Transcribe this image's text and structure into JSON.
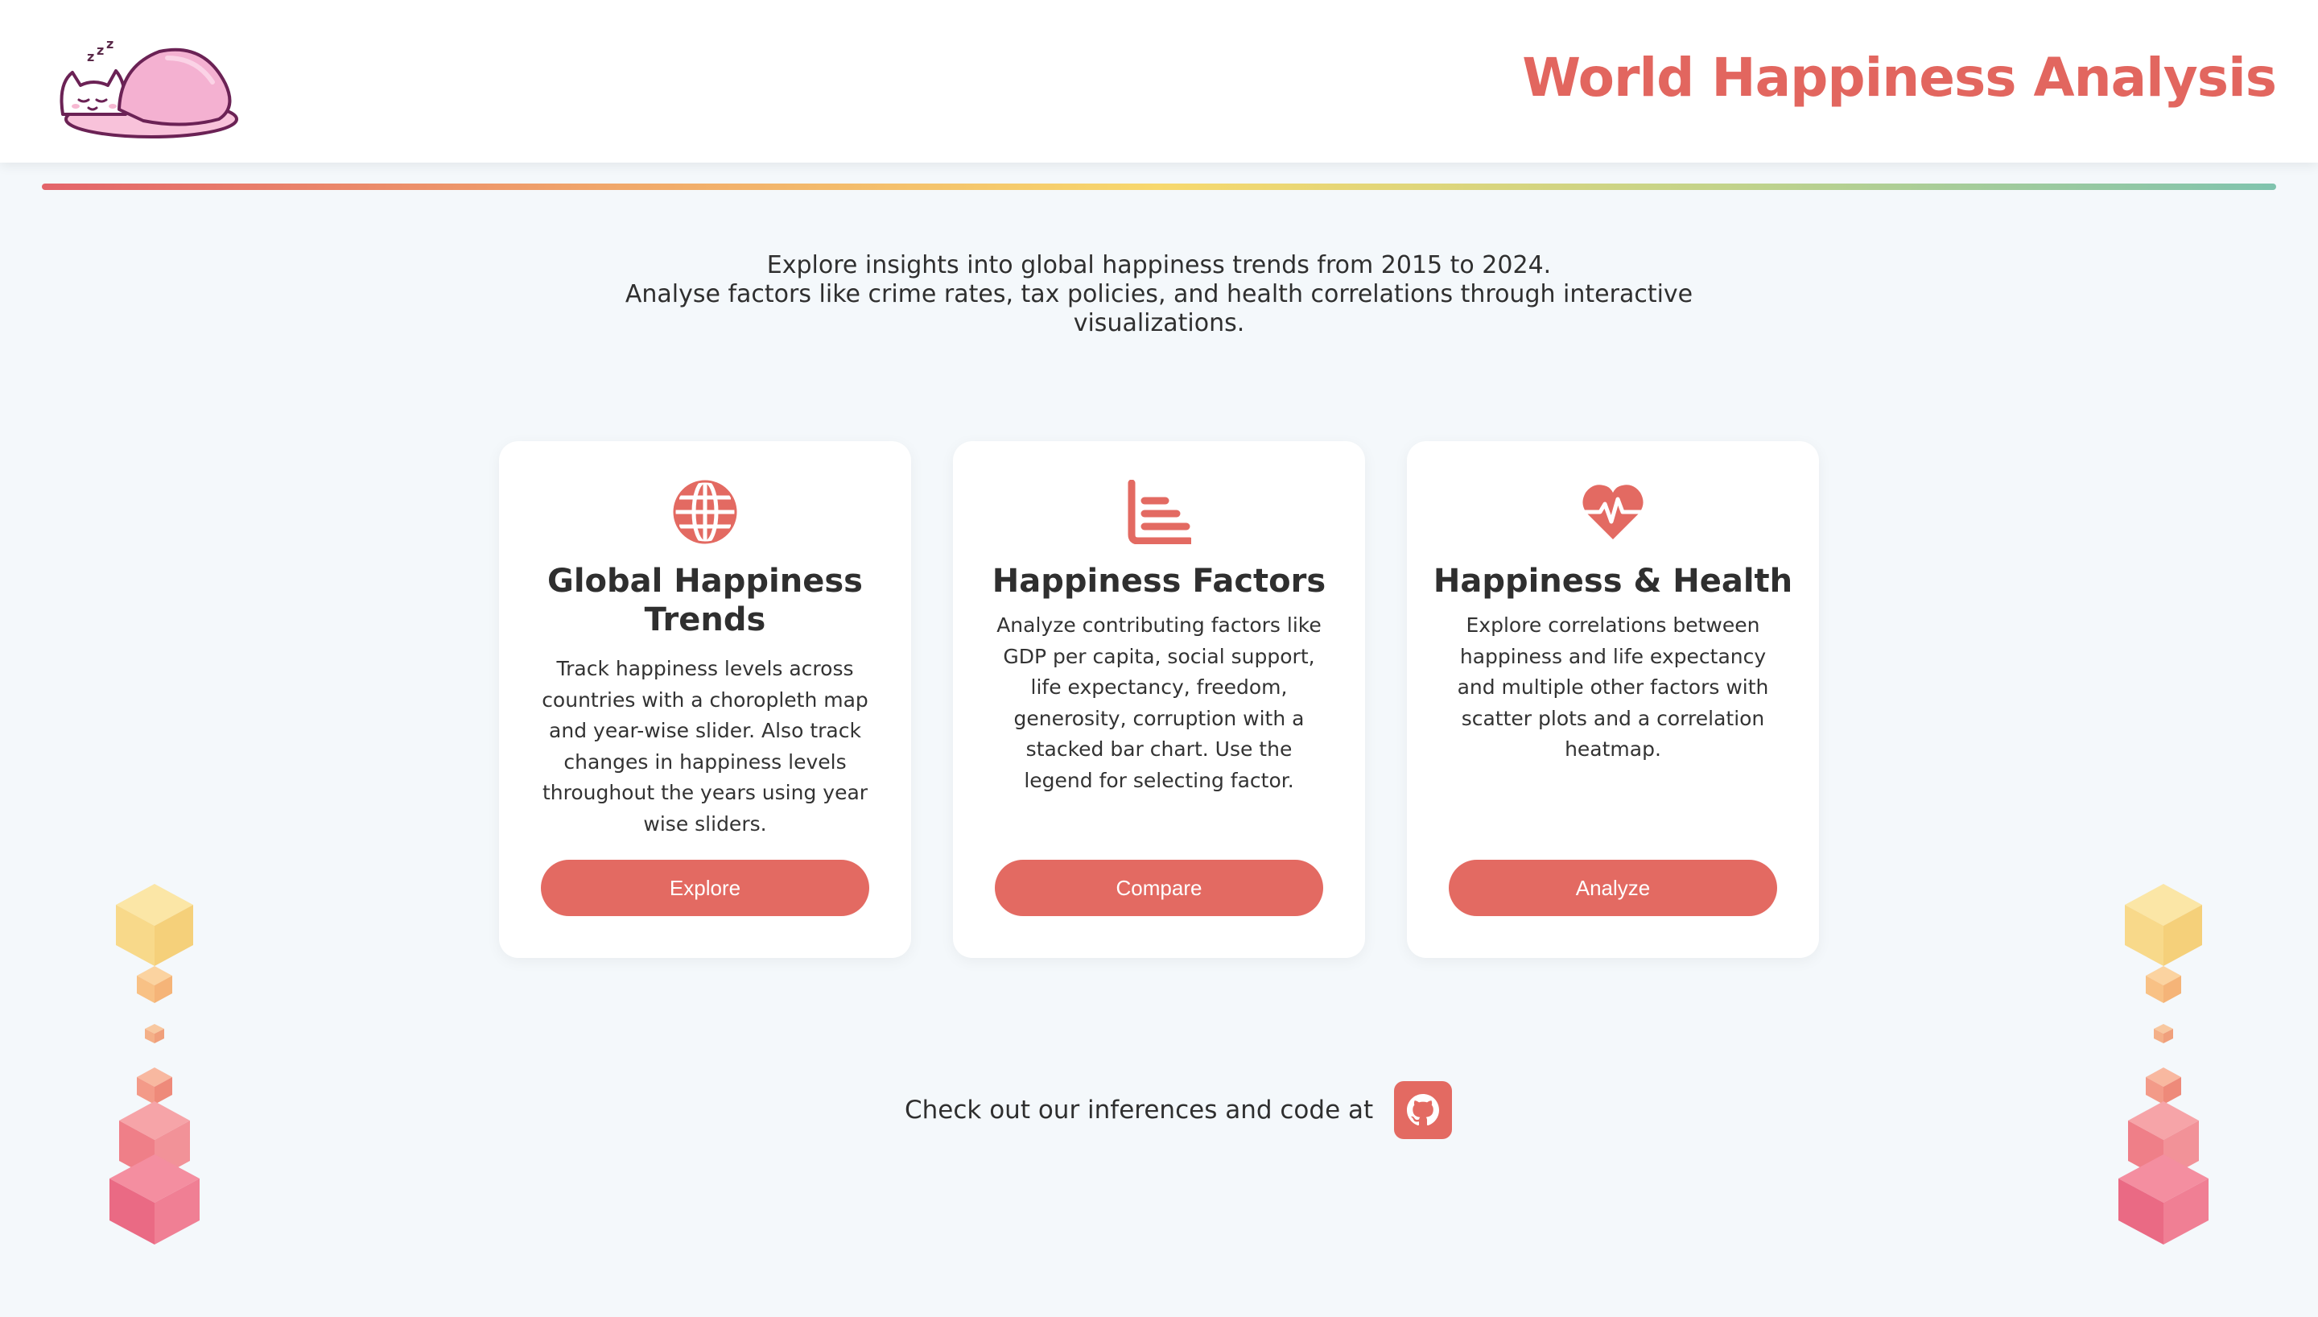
{
  "header": {
    "title": "World Happiness Analysis",
    "logo_icon": "sleeping-cat-icon"
  },
  "intro": {
    "line1": "Explore insights into global happiness trends from 2015 to 2024.",
    "line2": "Analyse factors like crime rates, tax policies, and health correlations through interactive visualizations."
  },
  "cards": [
    {
      "icon": "globe-icon",
      "title": "Global Happiness Trends",
      "description": "Track happiness levels across countries with a choropleth map and year-wise slider. Also track changes in happiness levels throughout the years using year wise sliders.",
      "button": "Explore"
    },
    {
      "icon": "bar-chart-icon",
      "title": "Happiness Factors",
      "description": "Analyze contributing factors like GDP per capita, social support, life expectancy, freedom, generosity, corruption with a stacked bar chart. Use the legend for selecting factor.",
      "button": "Compare"
    },
    {
      "icon": "heartbeat-icon",
      "title": "Happiness & Health",
      "description": "Explore correlations between happiness and life expectancy and multiple other factors with scatter plots and a correlation heatmap.",
      "button": "Analyze"
    }
  ],
  "footer": {
    "text": "Check out our inferences and code at",
    "link_icon": "github-icon"
  },
  "colors": {
    "accent": "#e36a62",
    "title": "#e2665f",
    "background": "#f4f8fb",
    "card": "#ffffff"
  }
}
